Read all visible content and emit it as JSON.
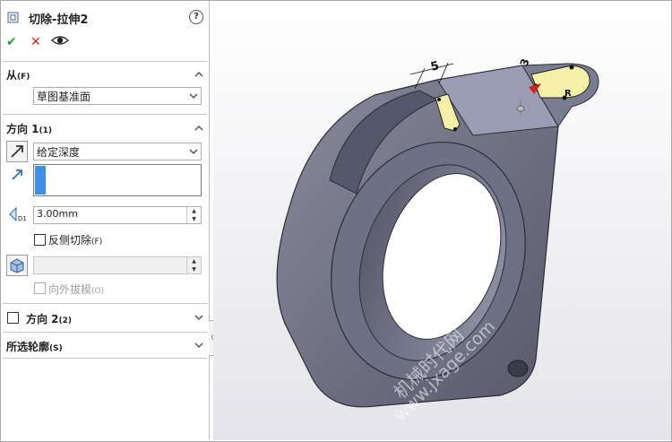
{
  "panel": {
    "title": "切除-拉伸2",
    "help_label": "?",
    "actions": {
      "ok_label": "✔",
      "cancel_label": "✕",
      "preview_label": "👁"
    },
    "from": {
      "header": "从",
      "header_key": "(F)",
      "selected": "草图基准面"
    },
    "direction1": {
      "header": "方向 1",
      "header_key": "(1)",
      "end_condition": "给定深度",
      "depth_value": "3.00mm",
      "flip_side_label": "反侧切除",
      "flip_side_key": "(F)",
      "flip_side_checked": false,
      "draft_outward_label": "向外拔模",
      "draft_outward_key": "(O)",
      "draft_outward_checked": false
    },
    "direction2": {
      "header": "方向 2",
      "header_key": "(2)",
      "checked": false
    },
    "selected_contours": {
      "header": "所选轮廓",
      "header_key": "(S)"
    }
  },
  "viewport": {
    "dimension_5": "5",
    "dimension_3": "3",
    "dimension_r": "R",
    "watermark_line1": "机械时代网",
    "watermark_line2": "www.jxage.com"
  },
  "colors": {
    "background_top": "#ffffff",
    "background_bottom": "#e4e4ea",
    "part_gray": "#6b6d7f",
    "part_top": "#9a9db4",
    "sketch_yellow": "#f5f0a8",
    "selection_blue": "#3d8fe8"
  }
}
